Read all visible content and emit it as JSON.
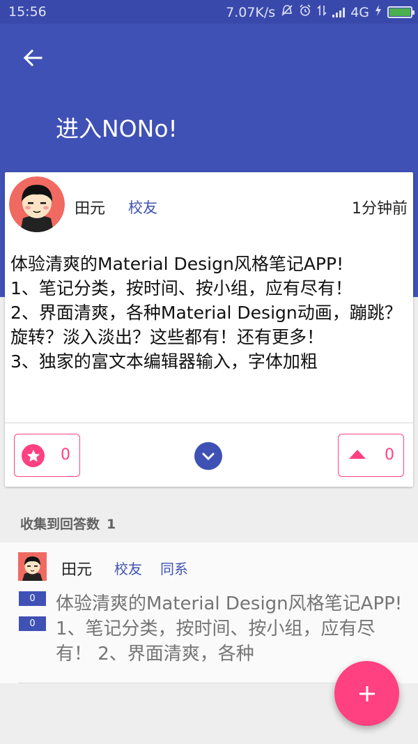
{
  "status_bar": {
    "time": "15:56",
    "network_speed": "7.07K/s",
    "network_type": "4G",
    "icons": [
      "mute-icon",
      "alarm-icon",
      "data-transfer-icon",
      "signal-icon",
      "charging-icon",
      "battery-icon"
    ],
    "battery_color": "#4caf50"
  },
  "app_bar": {
    "title": "进入NONo!",
    "back_icon": "back-arrow-icon",
    "color": "#3f51b5"
  },
  "question": {
    "author": "田元",
    "author_tag": "校友",
    "time": "1分钟前",
    "body": "体验清爽的Material Design风格笔记APP!\n1、笔记分类，按时间、按小组，应有尽有！\n2、界面清爽，各种Material Design动画，蹦跳？旋转？淡入淡出？这些都有！还有更多！\n3、独家的富文本编辑器输入，字体加粗",
    "favorite_count": "0",
    "upvote_count": "0",
    "accent": "#ff4081"
  },
  "answers_section": {
    "title": "收集到回答数",
    "count": "1"
  },
  "answers": [
    {
      "author": "田元",
      "tag_1": "校友",
      "tag_2": "同系",
      "vote_1": "0",
      "vote_2": "0",
      "excerpt": "体验清爽的Material Design风格笔记APP! 1、笔记分类，按时间、按小组，应有尽有！ 2、界面清爽，各种"
    }
  ],
  "fab": {
    "icon": "plus-icon"
  }
}
